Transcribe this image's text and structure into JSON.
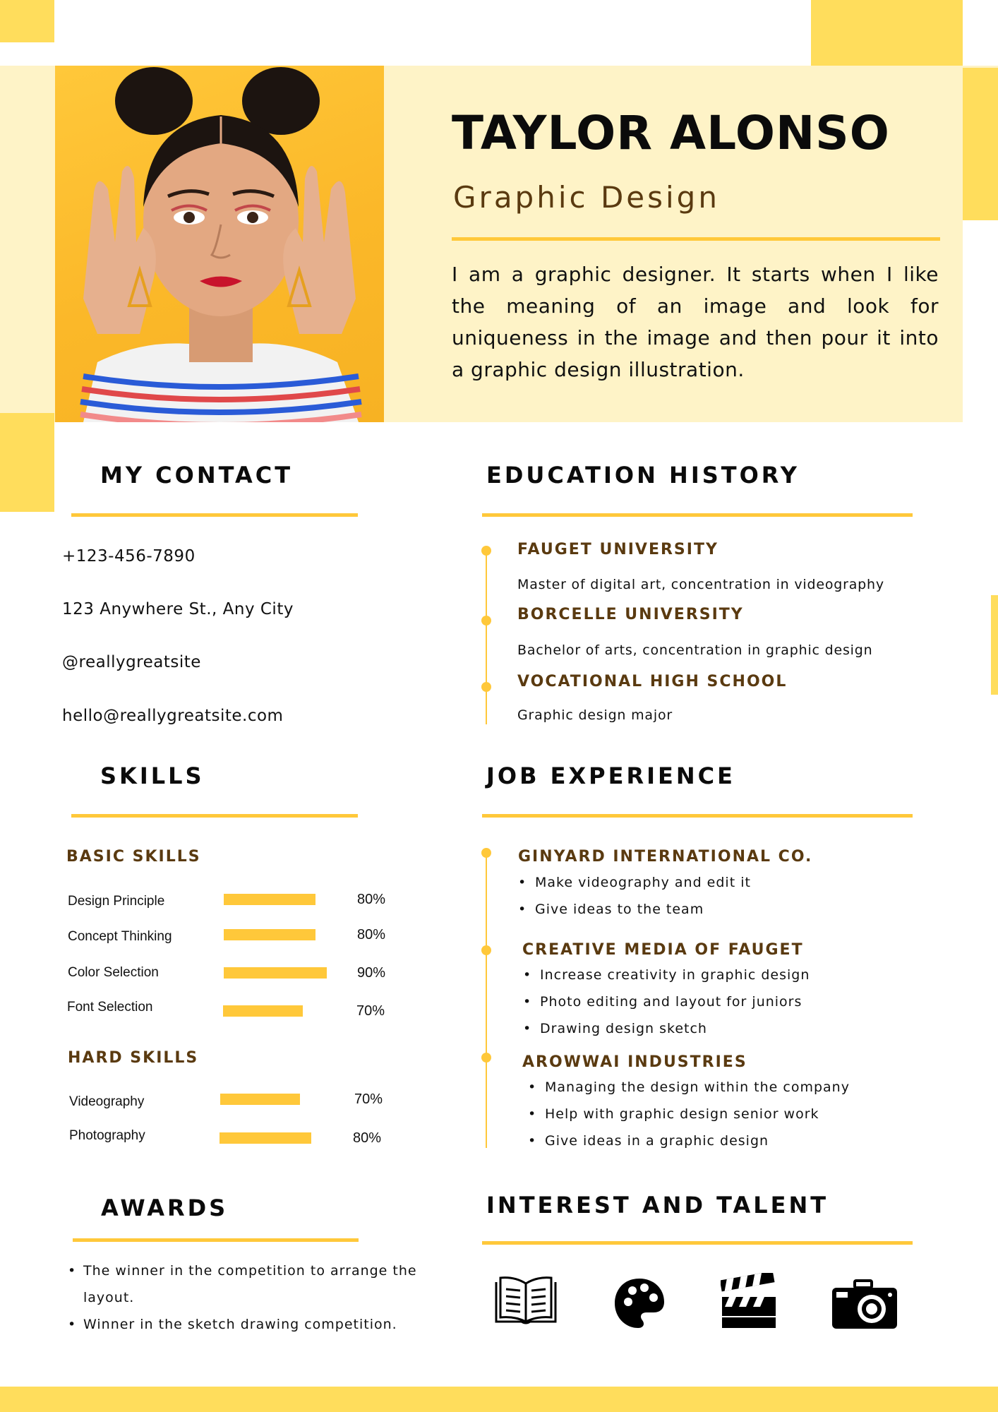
{
  "header": {
    "name": "TAYLOR ALONSO",
    "title": "Graphic Design",
    "bio": "I am a graphic designer. It starts when I like the meaning of an image and look for uniqueness in the image and then pour it into a graphic design illustration."
  },
  "contact": {
    "heading": "MY CONTACT",
    "phone": "+123-456-7890",
    "address": "123 Anywhere St., Any City",
    "social": "@reallygreatsite",
    "email": "hello@reallygreatsite.com"
  },
  "education": {
    "heading": "EDUCATION HISTORY",
    "items": [
      {
        "school": "FAUGET UNIVERSITY",
        "detail": "Master of digital art, concentration in videography"
      },
      {
        "school": "BORCELLE UNIVERSITY",
        "detail": "Bachelor of arts, concentration in graphic design"
      },
      {
        "school": "VOCATIONAL HIGH SCHOOL",
        "detail": "Graphic design major"
      }
    ]
  },
  "skills": {
    "heading": "SKILLS",
    "basic_label": "BASIC SKILLS",
    "basic": [
      {
        "name": "Design Principle",
        "percent_label": "80%",
        "level": 0.8
      },
      {
        "name": "Concept Thinking",
        "percent_label": "80%",
        "level": 0.8
      },
      {
        "name": "Color Selection",
        "percent_label": "90%",
        "level": 0.9
      },
      {
        "name": "Font Selection",
        "percent_label": "70%",
        "level": 0.7
      }
    ],
    "hard_label": "HARD SKILLS",
    "hard": [
      {
        "name": "Videography",
        "percent_label": "70%",
        "level": 0.7
      },
      {
        "name": "Photography",
        "percent_label": "80%",
        "level": 0.8
      }
    ]
  },
  "jobs": {
    "heading": "JOB EXPERIENCE",
    "items": [
      {
        "company": "GINYARD INTERNATIONAL CO.",
        "tasks": [
          "Make videography and edit it",
          "Give ideas to the team"
        ]
      },
      {
        "company": "CREATIVE MEDIA OF FAUGET",
        "tasks": [
          "Increase creativity in graphic design",
          "Photo editing and layout for juniors",
          "Drawing design sketch"
        ]
      },
      {
        "company": "AROWWAI INDUSTRIES",
        "tasks": [
          "Managing the design within the company",
          "Help with graphic design senior work",
          "Give ideas in a graphic design"
        ]
      }
    ]
  },
  "awards": {
    "heading": "AWARDS",
    "items": [
      "The winner in the competition to arrange the layout.",
      "Winner in the sketch drawing competition."
    ]
  },
  "interests": {
    "heading": "INTEREST AND TALENT",
    "icons": [
      "book-icon",
      "palette-icon",
      "clapperboard-icon",
      "camera-icon"
    ]
  },
  "colors": {
    "accent": "#FFC83A",
    "accent_soft": "#FFDD5C",
    "panel": "#FEF3C7",
    "brown": "#5A3A10"
  }
}
